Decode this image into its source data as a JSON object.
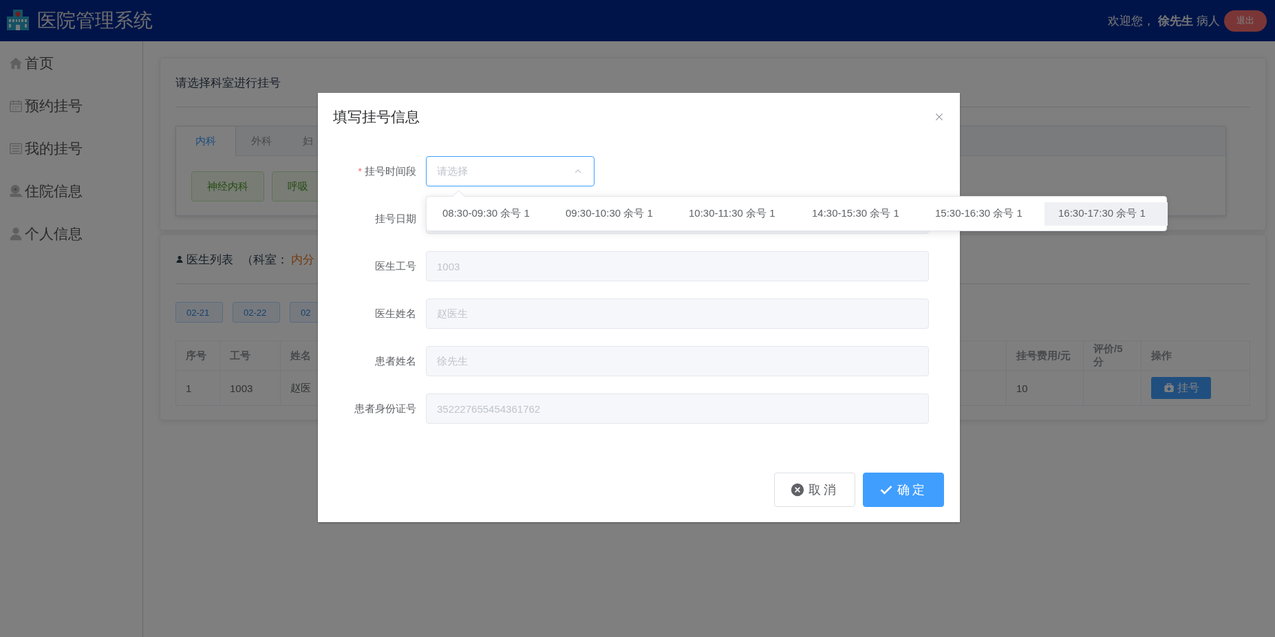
{
  "header": {
    "title": "医院管理系统",
    "greeting": "欢迎您，",
    "user_name": "徐先生",
    "role": "病人",
    "logout": "退出"
  },
  "sidebar": {
    "items": [
      {
        "label": "首页",
        "kind": "home"
      },
      {
        "label": "预约挂号",
        "kind": "calendar"
      },
      {
        "label": "我的挂号",
        "kind": "list"
      },
      {
        "label": "住院信息",
        "kind": "inpatient"
      },
      {
        "label": "个人信息",
        "kind": "user"
      }
    ]
  },
  "department_card": {
    "title": "请选择科室进行挂号",
    "tabs": [
      {
        "label": "内科",
        "selected": true
      },
      {
        "label": "外科",
        "selected": false
      },
      {
        "label": "妇",
        "selected": false
      }
    ],
    "departments": [
      "神经内科",
      "呼吸"
    ]
  },
  "doctor_card": {
    "title": "医生列表",
    "dept_prefix": "（科室：",
    "dept_name": "内分",
    "dates": [
      "02-21",
      "02-22",
      "02"
    ],
    "columns_left": [
      "序号",
      "工号",
      "姓名"
    ],
    "columns_right": [
      "挂号费用/元",
      "评价/5分",
      "操作"
    ],
    "rows": [
      {
        "no": "1",
        "id": "1003",
        "name": "赵医",
        "fee": "10",
        "action": "挂号"
      }
    ]
  },
  "dialog": {
    "title": "填写挂号信息",
    "fields": [
      {
        "label": "挂号时间段",
        "kind": "select",
        "required_mark": "*",
        "placeholder": "请选择",
        "open": true,
        "disabled": false
      },
      {
        "label": "挂号日期",
        "kind": "input",
        "disabled": true
      },
      {
        "label": "医生工号",
        "kind": "input",
        "value": "1003",
        "disabled": true
      },
      {
        "label": "医生姓名",
        "kind": "input",
        "value": "赵医生",
        "disabled": true
      },
      {
        "label": "患者姓名",
        "kind": "input",
        "value": "徐先生",
        "disabled": true
      },
      {
        "label": "患者身份证号",
        "kind": "input",
        "value": "352227655454361762",
        "disabled": true
      }
    ],
    "options": [
      {
        "label": "08:30-09:30 余号 1",
        "hovered": false
      },
      {
        "label": "09:30-10:30 余号 1",
        "hovered": false
      },
      {
        "label": "10:30-11:30 余号 1",
        "hovered": false
      },
      {
        "label": "14:30-15:30 余号 1",
        "hovered": false
      },
      {
        "label": "15:30-16:30 余号 1",
        "hovered": false
      },
      {
        "label": "16:30-17:30 余号 1",
        "hovered": true
      }
    ],
    "buttons": [
      {
        "label": "取消",
        "kind": "cancel"
      },
      {
        "label": "确定",
        "kind": "primary"
      }
    ]
  }
}
